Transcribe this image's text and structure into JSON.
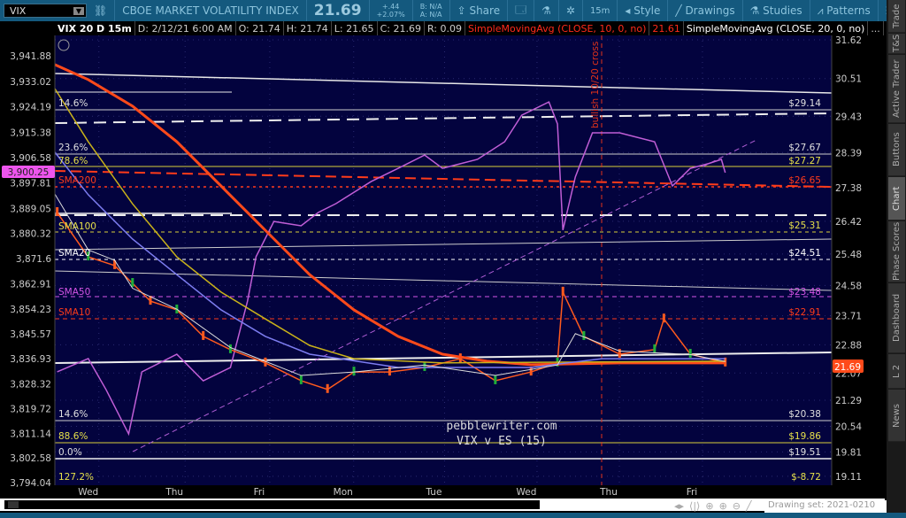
{
  "toolbar": {
    "symbol": "VIX",
    "description": "CBOE MARKET VOLATILITY INDEX",
    "last": "21.69",
    "change": "+.44",
    "change_pct": "+2.07%",
    "bid": "B: N/A",
    "ask": "A: N/A",
    "share": "Share",
    "timeframe": "15m",
    "style": "Style",
    "drawings": "Drawings",
    "studies": "Studies",
    "patterns": "Patterns"
  },
  "infobar": {
    "title": "VIX 20 D 15m",
    "date": "D: 2/12/21 6:00 AM",
    "open": "O: 21.74",
    "high": "H: 21.74",
    "low": "L: 21.65",
    "close": "C: 21.69",
    "range": "R: 0.09",
    "study1": "SimpleMovingAvg (CLOSE, 10, 0, no)",
    "study1_value": "21.61",
    "study2": "SimpleMovingAvg (CLOSE, 20, 0, no)",
    "more": "..."
  },
  "chart_data": {
    "type": "line",
    "left_axis_ticks": [
      "3,941.88",
      "3,933.02",
      "3,924.19",
      "3,915.38",
      "3,906.58",
      "3,897.81",
      "3,889.05",
      "3,880.32",
      "3,871.6",
      "3,862.91",
      "3,854.23",
      "3,845.57",
      "3,836.93",
      "3,828.32",
      "3,819.72",
      "3,811.14",
      "3,802.58",
      "3,794.04"
    ],
    "left_axis_values": [
      3941.88,
      3933.02,
      3924.19,
      3915.38,
      3906.58,
      3897.81,
      3889.05,
      3880.32,
      3871.6,
      3862.91,
      3854.23,
      3845.57,
      3836.93,
      3828.32,
      3819.72,
      3811.14,
      3802.58,
      3794.04
    ],
    "right_axis_ticks": [
      "31.62",
      "30.51",
      "29.43",
      "28.39",
      "27.38",
      "26.42",
      "25.48",
      "24.58",
      "23.71",
      "22.88",
      "22.07",
      "21.29",
      "20.54",
      "19.81",
      "19.11"
    ],
    "right_axis_values": [
      31.62,
      30.51,
      29.43,
      28.39,
      27.38,
      26.42,
      25.48,
      24.58,
      23.71,
      22.88,
      22.07,
      21.29,
      20.54,
      19.81,
      19.11
    ],
    "x_labels": [
      "Wed",
      "Thu",
      "Fri",
      "Mon",
      "Tue",
      "Wed",
      "Thu",
      "Fri"
    ],
    "x_label_index": [
      4.3,
      15.4,
      26.3,
      37.1,
      48.8,
      60.7,
      71.3,
      82.0
    ],
    "es_marker": "3,900.25",
    "vix_marker": "21.69",
    "annotation": "bullish 10/20 cross",
    "watermark1": "pebblewriter.com",
    "watermark2": "VIX v ES (15)",
    "series": [
      {
        "name": "ES",
        "color": "#c05ed6",
        "axis": "left",
        "x": [
          0.3,
          4.3,
          6.6,
          9.5,
          11.2,
          15.7,
          19.1,
          22.6,
          24.8,
          25.9,
          28.2,
          31.7,
          33.9,
          36.2,
          40.7,
          44.2,
          47.6,
          49.9,
          54.4,
          57.9,
          60.1,
          63.6,
          64.7,
          65.4,
          67.0,
          69.2,
          72.7,
          77.2,
          79.5,
          81.8,
          84.1,
          85.8,
          86.3
        ],
        "y": [
          3832.4,
          3837.0,
          3826.2,
          3810.9,
          3832.4,
          3838.5,
          3829.3,
          3833.9,
          3856.9,
          3872.3,
          3884.5,
          3883.0,
          3887.6,
          3890.7,
          3898.3,
          3902.9,
          3907.5,
          3902.9,
          3906.0,
          3912.1,
          3921.3,
          3925.9,
          3918.3,
          3881.5,
          3899.9,
          3915.2,
          3915.2,
          3912.1,
          3896.8,
          3902.9,
          3904.5,
          3906.0,
          3901.4
        ]
      },
      {
        "name": "VIX",
        "color": "#ff5a1e",
        "axis": "right",
        "x": [
          0.3,
          4.3,
          7.7,
          10.0,
          12.3,
          15.7,
          19.1,
          22.6,
          27.1,
          31.7,
          35.1,
          38.5,
          43.1,
          47.6,
          52.2,
          56.7,
          61.3,
          64.7,
          65.4,
          68.1,
          72.7,
          77.2,
          78.4,
          81.8,
          86.3
        ],
        "y": [
          26.67,
          25.4,
          25.15,
          24.64,
          24.13,
          23.88,
          23.12,
          22.74,
          22.36,
          21.85,
          21.6,
          22.1,
          22.1,
          22.23,
          22.48,
          21.85,
          22.1,
          22.36,
          24.39,
          23.12,
          22.61,
          22.74,
          23.62,
          22.61,
          22.36
        ]
      },
      {
        "name": "SMA200",
        "color": "#ff4a1a",
        "axis": "right",
        "x": [
          0,
          4.3,
          10.0,
          15.7,
          21.4,
          27.1,
          32.8,
          38.5,
          44.2,
          49.9,
          55.6,
          61.3,
          72.7,
          86.3
        ],
        "y": [
          30.91,
          30.48,
          29.72,
          28.7,
          27.43,
          26.16,
          24.89,
          23.88,
          23.12,
          22.61,
          22.41,
          22.31,
          22.36,
          22.36
        ]
      },
      {
        "name": "SMA100",
        "color": "#c9b21a",
        "axis": "right",
        "x": [
          0,
          4.3,
          10.0,
          15.7,
          21.4,
          27.1,
          32.8,
          38.5,
          49.9,
          86.3
        ],
        "y": [
          30.22,
          28.7,
          26.92,
          25.4,
          24.39,
          23.62,
          22.86,
          22.48,
          22.36,
          22.41
        ]
      },
      {
        "name": "SMA50",
        "color": "#7d7df0",
        "axis": "right",
        "x": [
          0,
          4.3,
          10.0,
          15.7,
          21.4,
          27.1,
          32.8,
          44.2,
          61.3,
          70.4,
          86.3
        ],
        "y": [
          28.4,
          27.18,
          25.91,
          24.89,
          23.88,
          23.12,
          22.61,
          22.23,
          22.23,
          22.48,
          22.48
        ]
      },
      {
        "name": "SMA20",
        "color": "#dddddd",
        "axis": "right",
        "x": [
          0,
          4.3,
          7.7,
          10.0,
          15.7,
          22.6,
          31.7,
          38.5,
          47.6,
          56.7,
          64.7,
          67.0,
          72.7,
          81.8,
          86.3
        ],
        "y": [
          27.2,
          25.6,
          25.3,
          24.5,
          23.9,
          22.8,
          22.0,
          22.1,
          22.3,
          22.0,
          22.3,
          23.2,
          22.7,
          22.6,
          22.4
        ]
      }
    ],
    "levels": [
      {
        "left": "14.6%",
        "right": "$29.14",
        "color": "#e0e0e0"
      },
      {
        "left": "23.6%",
        "right": "$27.67",
        "color": "#e0e0e0"
      },
      {
        "left": "78.6%",
        "right": "$27.27",
        "color": "#e6e04a"
      },
      {
        "left": "SMA200",
        "right": "$26.65",
        "color": "#ff3b1a"
      },
      {
        "left": "SMA100",
        "right": "$25.31",
        "color": "#e6e04a"
      },
      {
        "left": "SMA20",
        "right": "$24.51",
        "color": "#ffffff"
      },
      {
        "left": "SMA50",
        "right": "$23.48",
        "color": "#d555e6"
      },
      {
        "left": "SMA10",
        "right": "$22.91",
        "color": "#ff3b1a"
      },
      {
        "left": "14.6%",
        "right": "$20.38",
        "color": "#e0e0e0"
      },
      {
        "left": "88.6%",
        "right": "$19.86",
        "color": "#e6e04a"
      },
      {
        "left": "0.0%",
        "right": "$19.51",
        "color": "#e0e0e0"
      },
      {
        "left": "127.2%",
        "right": "$-8.72",
        "color": "#e6e04a"
      }
    ]
  },
  "sidebar": {
    "tabs": [
      "Trade",
      "T&S",
      "Active Trader",
      "Buttons",
      "Chart",
      "Phase Scores",
      "Dashboard",
      "L 2",
      "News"
    ],
    "active": "Chart"
  },
  "footer": {
    "drawing_set": "Drawing set: 2021-0210"
  }
}
